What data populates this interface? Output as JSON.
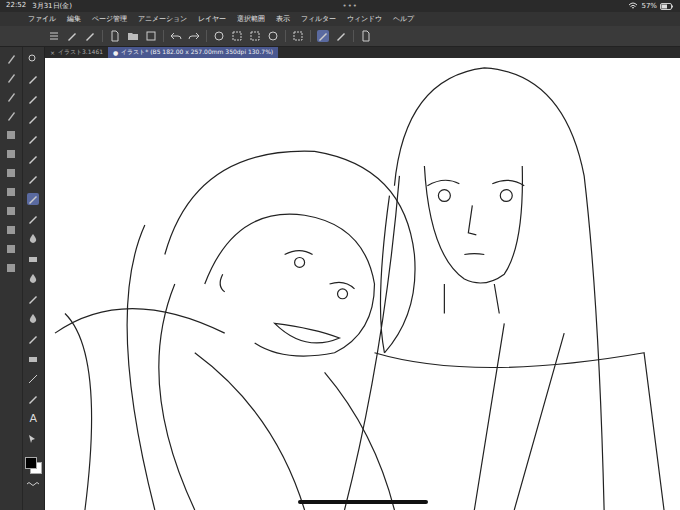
{
  "status_bar": {
    "time": "22:52",
    "date": "3月31日(金)",
    "dots": "•••",
    "battery": "57%"
  },
  "menu": [
    "ファイル",
    "編集",
    "ページ管理",
    "アニメーション",
    "レイヤー",
    "選択範囲",
    "表示",
    "フィルター",
    "ウィンドウ",
    "ヘルプ"
  ],
  "tabs": [
    {
      "label": "イラスト3.1461",
      "mark": "×",
      "selected": false
    },
    {
      "label": "イラスト* (B5 182.00 x 257.00mm 350dpi 130.7%)",
      "mark": "●",
      "selected": true
    }
  ],
  "tools": {
    "text_tool": "A"
  }
}
